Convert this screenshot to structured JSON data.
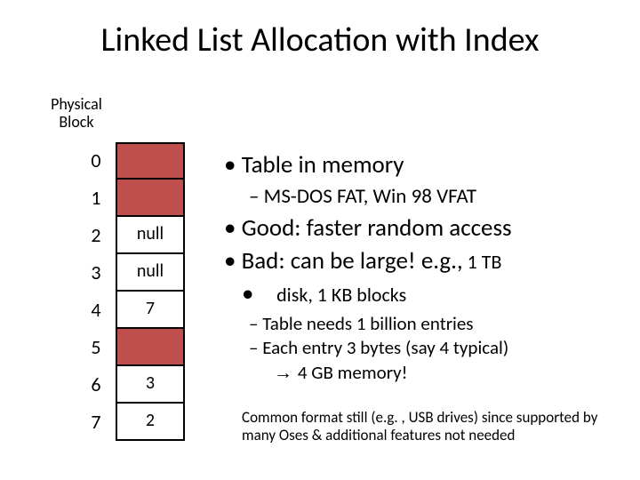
{
  "title": "Linked List Allocation with Index",
  "physical_block_label_l1": "Physical",
  "physical_block_label_l2": "Block",
  "table": {
    "rows": [
      {
        "index": "0",
        "value": "",
        "shaded": true
      },
      {
        "index": "1",
        "value": "",
        "shaded": true
      },
      {
        "index": "2",
        "value": "null",
        "shaded": false
      },
      {
        "index": "3",
        "value": "null",
        "shaded": false
      },
      {
        "index": "4",
        "value": "7",
        "shaded": false
      },
      {
        "index": "5",
        "value": "",
        "shaded": true
      },
      {
        "index": "6",
        "value": "3",
        "shaded": false
      },
      {
        "index": "7",
        "value": "2",
        "shaded": false
      }
    ]
  },
  "bullets": {
    "b1": "Table in memory",
    "b1_sub": "MS-DOS FAT, Win 98 VFAT",
    "b2": "Good: faster random access",
    "b3_a": "Bad: can be large! e.g.,",
    "b3_b": " 1 TB",
    "b3_cont": "disk, 1 KB blocks",
    "b3_sub1": "Table needs 1 billion entries",
    "b3_sub2": "Each entry 3 bytes (say 4 typical)",
    "b3_sub2_cont": "4 GB memory!"
  },
  "footnote": "Common format still (e.g. , USB drives) since supported by many Oses & additional features not needed"
}
